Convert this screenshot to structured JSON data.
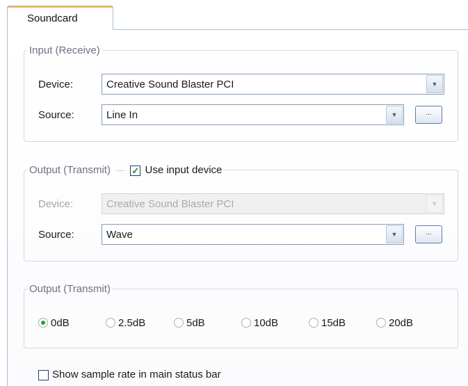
{
  "tab": {
    "label": "Soundcard"
  },
  "input_group": {
    "legend": "Input (Receive)",
    "device_label": "Device:",
    "device_value": "Creative Sound Blaster PCI",
    "source_label": "Source:",
    "source_value": "Line In",
    "browse_label": "..."
  },
  "output_group": {
    "legend": "Output (Transmit)",
    "use_input_label": "Use input device",
    "use_input_checked": true,
    "device_label": "Device:",
    "device_value": "Creative Sound Blaster PCI",
    "device_enabled": false,
    "source_label": "Source:",
    "source_value": "Wave",
    "browse_label": "..."
  },
  "gain_group": {
    "legend": "Output (Transmit)",
    "options": [
      "0dB",
      "2.5dB",
      "5dB",
      "10dB",
      "15dB",
      "20dB"
    ],
    "selected": "0dB"
  },
  "status_option": {
    "label": "Show sample rate in main status bar",
    "checked": false
  },
  "icons": {
    "dropdown": "chevron-down-icon",
    "check": "checkmark-icon"
  },
  "colors": {
    "tab_accent": "#f2b84b",
    "border_blue": "#7f9db9",
    "radio_selected": "#2c9c3a",
    "check_mark": "#1a8a1a",
    "legend_text": "#6b7280",
    "disabled_text": "#a0a4aa"
  }
}
